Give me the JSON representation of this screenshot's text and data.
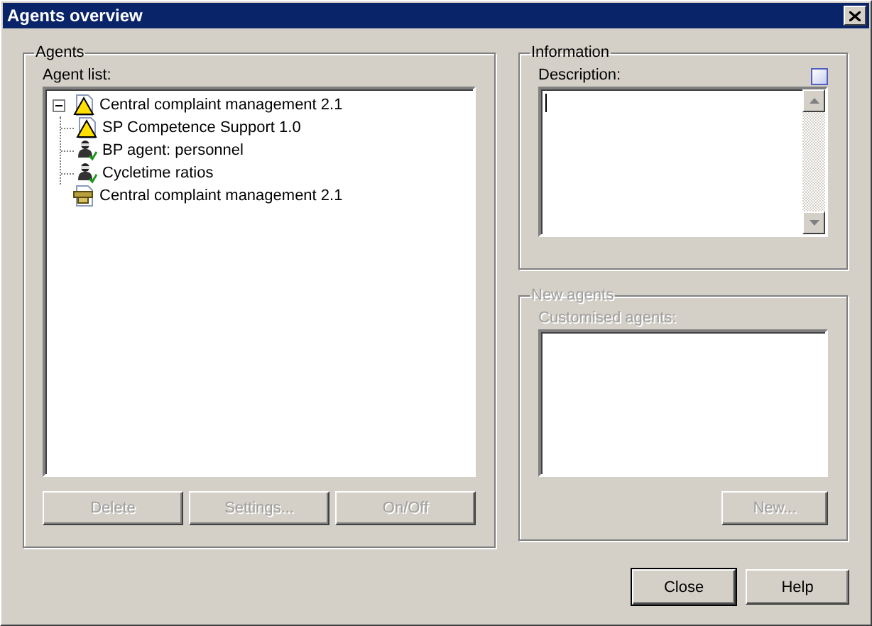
{
  "window": {
    "title": "Agents overview"
  },
  "agents": {
    "title": "Agents",
    "list_label": "Agent list:",
    "tree": [
      {
        "label": "Central complaint management 2.1",
        "kind": "warning",
        "expanded": true,
        "children": [
          {
            "label": "SP Competence Support 1.0",
            "kind": "warning"
          },
          {
            "label": "BP agent: personnel",
            "kind": "agent"
          },
          {
            "label": "Cycletime ratios",
            "kind": "agent"
          }
        ]
      },
      {
        "label": "Central complaint management 2.1",
        "kind": "package"
      }
    ],
    "buttons": [
      {
        "label": "Delete",
        "disabled": true
      },
      {
        "label": "Settings...",
        "disabled": true
      },
      {
        "label": "On/Off",
        "disabled": true
      }
    ]
  },
  "information": {
    "title": "Information",
    "description_label": "Description:"
  },
  "new_agents": {
    "title": "New agents",
    "disabled": true,
    "list_label": "Customised agents:",
    "button": {
      "label": "New...",
      "disabled": true
    }
  },
  "buttons": [
    {
      "label": "Close",
      "default": true
    },
    {
      "label": "Help",
      "default": false
    }
  ]
}
